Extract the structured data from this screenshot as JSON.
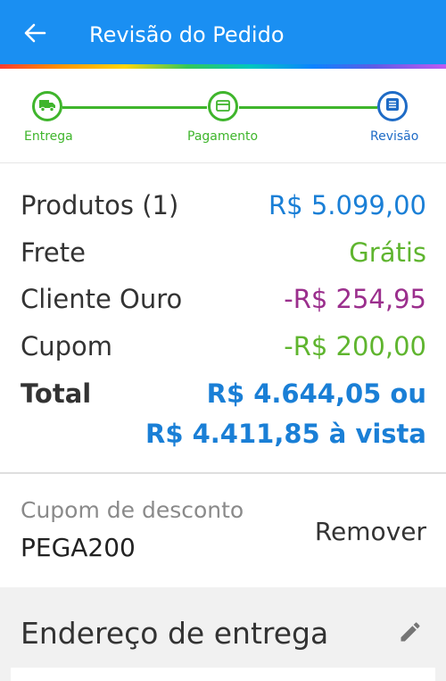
{
  "header": {
    "title": "Revisão do Pedido",
    "back_icon": "arrow-left-icon",
    "background": "#1a8ff2"
  },
  "steps": [
    {
      "label": "Entrega",
      "icon": "truck-icon",
      "state": "done"
    },
    {
      "label": "Pagamento",
      "icon": "credit-card-icon",
      "state": "done"
    },
    {
      "label": "Revisão",
      "icon": "list-icon",
      "state": "current"
    }
  ],
  "summary": {
    "products_label": "Produtos (1)",
    "products_value": "R$ 5.099,00",
    "shipping_label": "Frete",
    "shipping_value": "Grátis",
    "gold_label": "Cliente Ouro",
    "gold_value": "-R$ 254,95",
    "coupon_label": "Cupom",
    "coupon_value": "-R$ 200,00",
    "total_label": "Total",
    "total_value_line1": "R$ 4.644,05 ou",
    "total_value_line2": "R$ 4.411,85 à vista"
  },
  "coupon": {
    "label": "Cupom de desconto",
    "code": "PEGA200",
    "remove_label": "Remover"
  },
  "address": {
    "title": "Endereço de entrega",
    "edit_icon": "pencil-icon"
  },
  "colors": {
    "accent_blue": "#1a7fd6",
    "step_green": "#3fb52c",
    "discount_purple": "#9b2f8d",
    "free_green": "#5fb52f"
  }
}
